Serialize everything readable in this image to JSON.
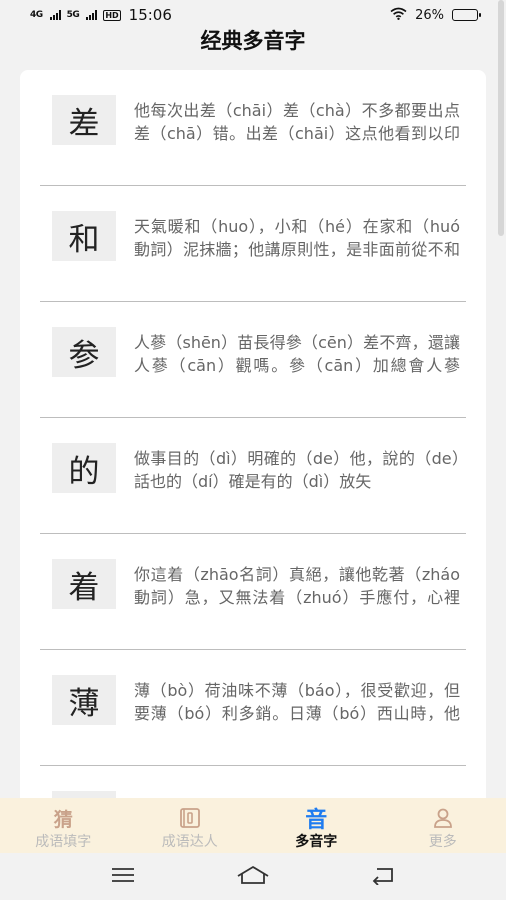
{
  "status_bar": {
    "network_1": "4G",
    "network_2": "5G",
    "hd_badge": "HD",
    "time": "15:06",
    "battery_text": "26%",
    "battery_level": 0.26
  },
  "page_title": "经典多音字",
  "entries": [
    {
      "char": "差",
      "desc": "他每次出差（chāi）差（chà）不多都要出点差（chā）错。出差（chāi）这点他看到以印照差"
    },
    {
      "char": "和",
      "desc": "天氣暖和（huo），小和（hé）在家和（huó動詞）泥抹牆；他講原則性，是非面前從不和（hè）稀泥"
    },
    {
      "char": "参",
      "desc": "人蔘（shēn）苗長得參（cēn）差不齊，還讓人蔘（cān）觀嗎。參（cān）加總會人蔘（shēn）種植"
    },
    {
      "char": "的",
      "desc": "做事目的（dì）明確的（de）他，說的（de）話也的（dí）確是有的（dì）放矢"
    },
    {
      "char": "着",
      "desc": "你這着（zhāo名詞）真絕，讓他乾著（zháo動詞）急，又無法着（zhuó）手應付，心裡老是懸着（zhe）"
    },
    {
      "char": "薄",
      "desc": "薄（bò）荷油味不薄（báo），很受歡迎，但要薄（bó）利多銷。日薄（bó）西山時，他才在床薄（bó）上"
    },
    {
      "char": "",
      "desc": ""
    }
  ],
  "nav": [
    {
      "label": "成语填字",
      "icon": "guess-icon",
      "glyph": "猜"
    },
    {
      "label": "成语达人",
      "icon": "book-icon",
      "glyph": ""
    },
    {
      "label": "多音字",
      "icon": "sound-icon",
      "glyph": "音"
    },
    {
      "label": "更多",
      "icon": "profile-icon",
      "glyph": ""
    }
  ],
  "colors": {
    "accent": "#1f7cf0",
    "nav_background": "#faf1dd",
    "page_background": "#f2f2f2"
  }
}
